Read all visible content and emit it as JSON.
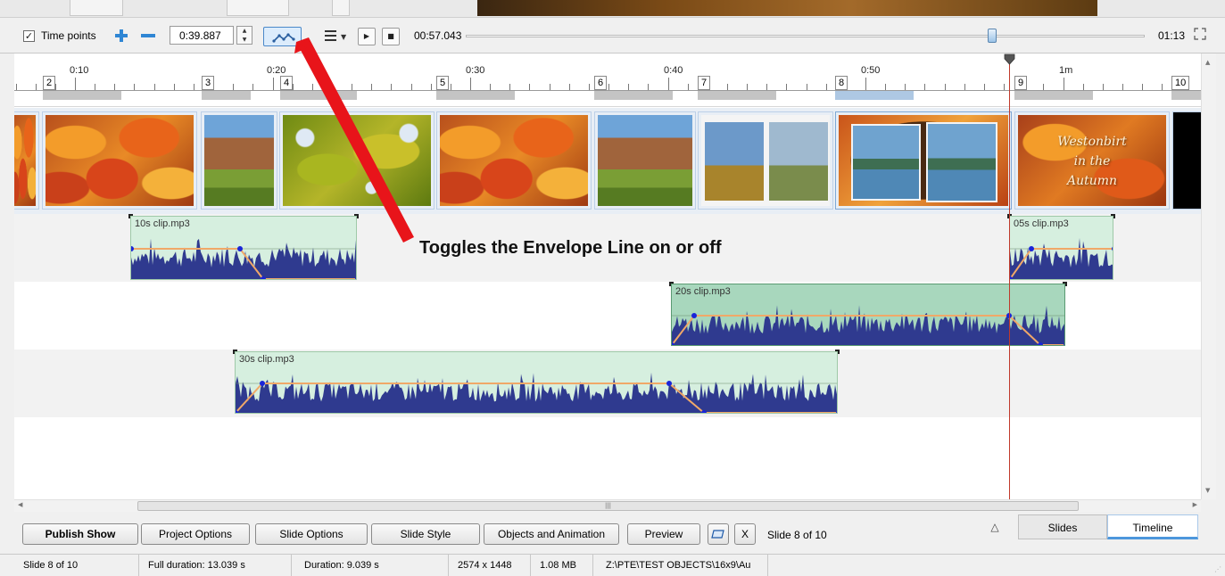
{
  "toolbar": {
    "time_points_label": "Time points",
    "time_points_checked": "✓",
    "current_time": "0:39.887",
    "playhead_time": "00:57.043",
    "total_time": "01:13",
    "envelope_toggle_active": true
  },
  "ruler": {
    "time_labels": [
      "0:10",
      "0:20",
      "0:30",
      "0:40",
      "0:50",
      "1m"
    ],
    "slide_markers": [
      "2",
      "3",
      "4",
      "5",
      "6",
      "7",
      "8",
      "9",
      "10"
    ]
  },
  "thumbnails": {
    "last_slide_text": [
      "Westonbirt",
      "in the",
      "Autumn"
    ]
  },
  "audio_clips": [
    {
      "name": "10s clip.mp3"
    },
    {
      "name": "05s clip.mp3"
    },
    {
      "name": "20s clip.mp3",
      "selected": true
    },
    {
      "name": "30s clip.mp3"
    }
  ],
  "annotation": {
    "text": "Toggles the Envelope Line on or off"
  },
  "buttons": {
    "publish_show": "Publish Show",
    "project_options": "Project Options",
    "slide_options": "Slide Options",
    "slide_style": "Slide Style",
    "objects_and_animation": "Objects and Animation",
    "preview": "Preview",
    "close_x": "X",
    "slide_counter": "Slide 8 of 10"
  },
  "view_tabs": {
    "collapse_glyph": "△",
    "slides": "Slides",
    "timeline": "Timeline",
    "active": "Timeline"
  },
  "status_bar": {
    "slide": "Slide 8 of 10",
    "full_duration": "Full duration: 13.039 s",
    "duration": "Duration: 9.039 s",
    "resolution": "2574 x 1448",
    "size": "1.08 MB",
    "path": "Z:\\PTE\\TEST OBJECTS\\16x9\\Au"
  },
  "colors": {
    "waveform": "#2f3a8f",
    "envelope_line": "#f0a868",
    "envelope_point": "#1a24d8",
    "clip_fill": "#d6efdf",
    "clip_selected_fill": "#a8d7bd",
    "playhead": "#c0392b",
    "callout_arrow": "#e8141a",
    "accent": "#2f86d4"
  }
}
